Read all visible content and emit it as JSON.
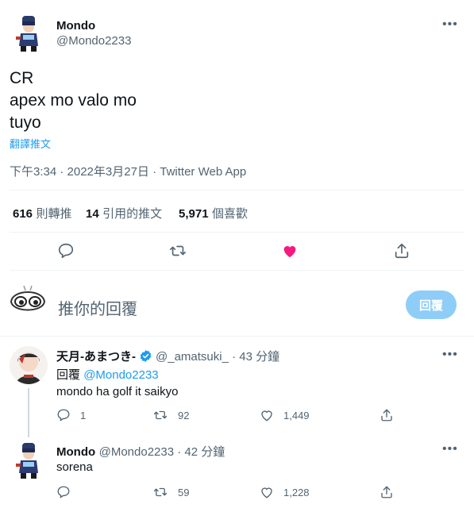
{
  "main_tweet": {
    "display_name": "Mondo",
    "handle": "@Mondo2233",
    "text_lines": [
      "CR",
      "apex mo valo mo",
      "tuyo"
    ],
    "translate_label": "翻譯推文",
    "timestamp": "下午3:34 · 2022年3月27日 · Twitter Web App",
    "stats": {
      "retweets_count": "616",
      "retweets_label": "則轉推",
      "quotes_count": "14",
      "quotes_label": "引用的推文",
      "likes_count": "5,971",
      "likes_label": "個喜歡"
    },
    "liked_color": "#f91880"
  },
  "compose": {
    "placeholder": "推你的回覆",
    "reply_button_label": "回覆"
  },
  "replies": [
    {
      "display_name": "天月-あまつき-",
      "verified": true,
      "handle_time": "@_amatsuki_ · 43 分鐘",
      "replying_prefix": "回覆",
      "replying_to": "@Mondo2233",
      "text": "mondo ha golf it saikyo",
      "reply_count": "1",
      "retweet_count": "92",
      "like_count": "1,449"
    },
    {
      "display_name": "Mondo",
      "handle_time": "@Mondo2233 · 42 分鐘",
      "text": "sorena",
      "reply_count": "",
      "retweet_count": "59",
      "like_count": "1,228"
    }
  ],
  "colors": {
    "accent": "#1d9bf0",
    "muted": "#536471",
    "like_active": "#f91880",
    "verified": "#1d9bf0"
  }
}
